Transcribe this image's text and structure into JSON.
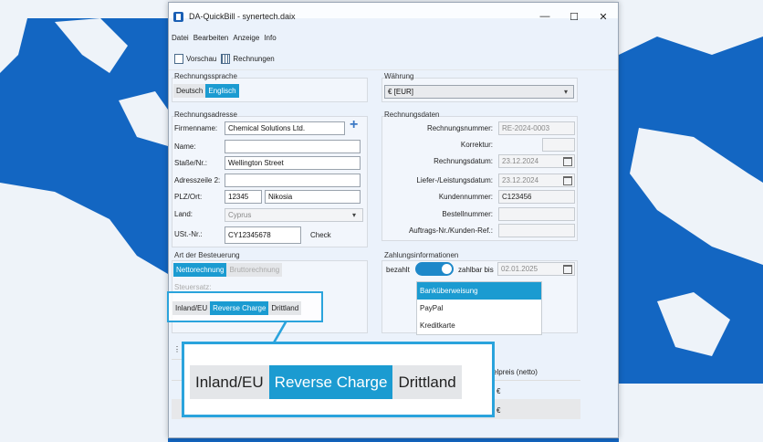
{
  "window": {
    "title": "DA-QuickBill - synertech.daix",
    "controls": [
      "—",
      "☐",
      "✕"
    ]
  },
  "menu": [
    "Datei",
    "Bearbeiten",
    "Anzeige",
    "Info"
  ],
  "toolbar": {
    "preview": "Vorschau",
    "invoices": "Rechnungen"
  },
  "language": {
    "label": "Rechnungssprache",
    "options": [
      "Deutsch",
      "Englisch"
    ],
    "selected": "Englisch"
  },
  "currency": {
    "label": "Währung",
    "value": "€ [EUR]"
  },
  "address": {
    "label": "Rechnungsadresse",
    "company_label": "Firmenname:",
    "company": "Chemical Solutions Ltd.",
    "name_label": "Name:",
    "name": "",
    "street_label": "Staße/Nr.:",
    "street": "Wellington Street",
    "line2_label": "Adresszeile 2:",
    "line2": "",
    "zip_label": "PLZ/Ort:",
    "zip": "12345",
    "city": "Nikosia",
    "country_label": "Land:",
    "country": "Cyprus",
    "vat_label": "USt.-Nr.:",
    "vat": "CY12345678",
    "check": "Check"
  },
  "invoice": {
    "label": "Rechnungsdaten",
    "number_label": "Rechnungsnummer:",
    "number": "RE-2024-0003",
    "correction_label": "Korrektur:",
    "date_label": "Rechnungsdatum:",
    "date": "23.12.2024",
    "delivery_label": "Liefer-/Leistungsdatum:",
    "delivery": "23.12.2024",
    "customer_label": "Kundennummer:",
    "customer": "C123456",
    "order_label": "Bestellnummer:",
    "order": "",
    "ref_label": "Auftrags-Nr./Kunden-Ref.:",
    "ref": ""
  },
  "tax": {
    "label": "Art der Besteuerung",
    "modes": [
      "Nettorechnung",
      "Bruttorechnung"
    ],
    "rate_label": "Steuersatz:",
    "types": [
      "Inland/EU",
      "Reverse Charge",
      "Drittland"
    ],
    "selected_type": "Reverse Charge"
  },
  "payment": {
    "label": "Zahlungsinformationen",
    "paid_label": "bezahlt",
    "due_label": "zahlbar bis",
    "due": "02.01.2025",
    "methods": [
      "Banküberweisung",
      "PayPal",
      "Kreditkarte"
    ],
    "selected": "Banküberweisung"
  },
  "items": {
    "col_unit_price": "elpreis (netto)",
    "rows": [
      "€",
      "€"
    ]
  },
  "colors": {
    "accent": "#1b9bd1",
    "highlight": "#2aa3dc",
    "map_land": "#1366c2"
  }
}
